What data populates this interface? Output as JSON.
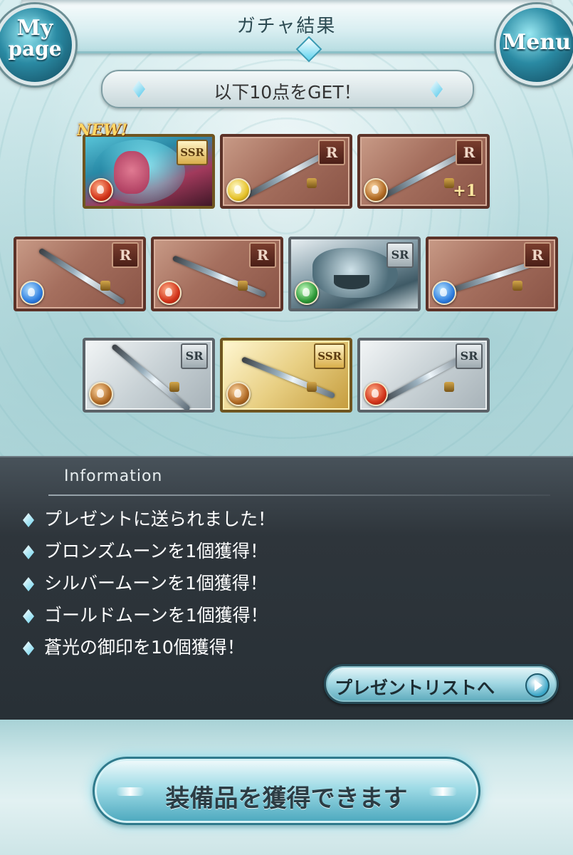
{
  "header": {
    "title": "ガチャ結果",
    "mypage_line1": "My",
    "mypage_line2": "page",
    "menu_label": "Menu"
  },
  "result_bar": {
    "text": "以下10点をGET！"
  },
  "new_badge": "NEW!",
  "items": [
    {
      "rarity": "SSR",
      "element": "fire",
      "kind": "character",
      "frame": "art-char",
      "new": true
    },
    {
      "rarity": "R",
      "element": "light",
      "kind": "sword",
      "frame": "bronze"
    },
    {
      "rarity": "R",
      "element": "earth",
      "kind": "sword",
      "frame": "bronze",
      "plus": "+1"
    },
    {
      "rarity": "R",
      "element": "water",
      "kind": "blade",
      "frame": "bronze"
    },
    {
      "rarity": "R",
      "element": "fire",
      "kind": "spear",
      "frame": "bronze"
    },
    {
      "rarity": "SR",
      "element": "wind",
      "kind": "summon",
      "frame": "art-dragon"
    },
    {
      "rarity": "R",
      "element": "water",
      "kind": "bow",
      "frame": "bronze"
    },
    {
      "rarity": "SR",
      "element": "earth",
      "kind": "axe",
      "frame": "silver"
    },
    {
      "rarity": "SSR",
      "element": "earth",
      "kind": "spear",
      "frame": "gold"
    },
    {
      "rarity": "SR",
      "element": "fire",
      "kind": "sword",
      "frame": "silver"
    }
  ],
  "information": {
    "title": "Information",
    "lines": [
      "プレゼントに送られました！",
      "ブロンズムーンを1個獲得！",
      "シルバームーンを1個獲得！",
      "ゴールドムーンを1個獲得！",
      "蒼光の御印を10個獲得！"
    ],
    "present_button": "プレゼントリストへ"
  },
  "bottom": {
    "equip_button": "装備品を獲得できます"
  },
  "colors": {
    "panel_bg": "#2e353b",
    "accent": "#5fd4f0",
    "fire": "#d2341a",
    "water": "#2f7fe0",
    "earth": "#b06a24",
    "wind": "#2e9a38",
    "light": "#e6c22a"
  }
}
